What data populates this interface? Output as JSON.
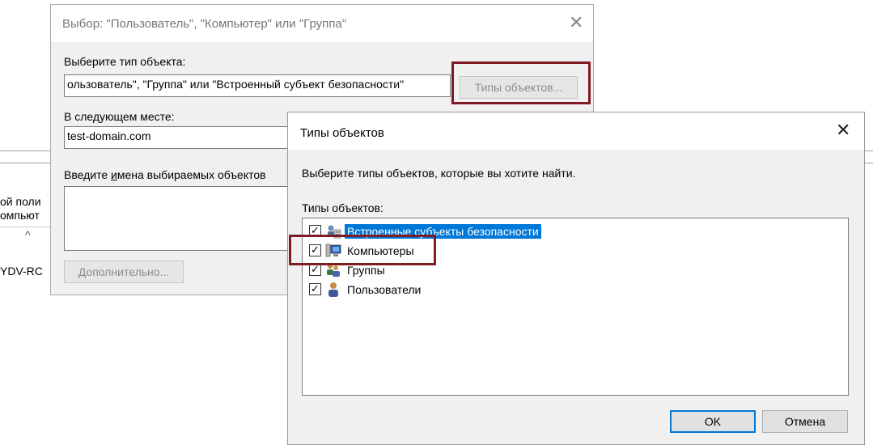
{
  "background": {
    "left_texts": [
      "ой поли",
      "омпьют"
    ],
    "caret": "^",
    "server_text": "YDV-RC"
  },
  "select_dialog": {
    "title": "Выбор: \"Пользователь\", \"Компьютер\" или \"Группа\"",
    "object_type_label": "Выберите тип объекта:",
    "object_type_value": "ользователь\", \"Группа\" или \"Встроенный субъект безопасности\"",
    "object_types_button": "Типы объектов...",
    "location_label": "В следующем месте:",
    "location_value": "test-domain.com",
    "names_label": "Введите имена выбираемых объектов",
    "advanced_button": "Дополнительно..."
  },
  "types_dialog": {
    "title": "Типы объектов",
    "description": "Выберите типы объектов, которые вы хотите найти.",
    "list_label": "Типы объектов:",
    "items": [
      {
        "label": "Встроенные субъекты безопасности",
        "checked": true,
        "selected": true,
        "icon": "security-principal-icon"
      },
      {
        "label": "Компьютеры",
        "checked": true,
        "selected": false,
        "icon": "computer-icon"
      },
      {
        "label": "Группы",
        "checked": true,
        "selected": false,
        "icon": "group-icon"
      },
      {
        "label": "Пользователи",
        "checked": true,
        "selected": false,
        "icon": "user-icon"
      }
    ],
    "ok_button": "OK",
    "cancel_button": "Отмена"
  },
  "colors": {
    "highlight_frame": "#7e1b24",
    "selection": "#0078d7",
    "dialog_bg": "#f0f0f0"
  }
}
